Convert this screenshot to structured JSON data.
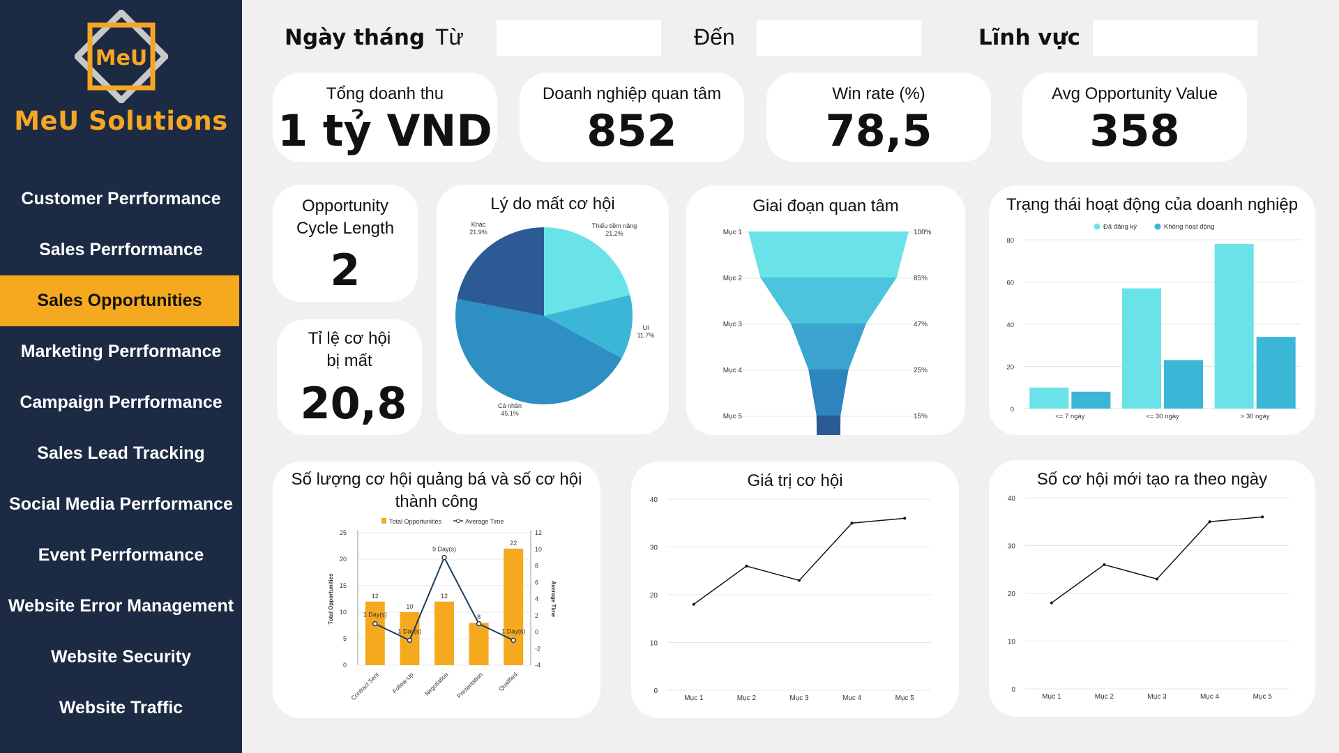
{
  "brand": {
    "logo_text": "MeU",
    "name": "MeU Solutions",
    "accent": "#f5a623"
  },
  "sidebar": {
    "items": [
      {
        "label": "Customer Perrformance"
      },
      {
        "label": "Sales Perrformance"
      },
      {
        "label": "Sales Opportunities",
        "active": true
      },
      {
        "label": "Marketing Perrformance"
      },
      {
        "label": "Campaign Perrformance"
      },
      {
        "label": "Sales Lead Tracking"
      },
      {
        "label": "Social Media Perrformance"
      },
      {
        "label": "Event Perrformance"
      },
      {
        "label": "Website Error Management"
      },
      {
        "label": "Website Security"
      },
      {
        "label": "Website Traffic"
      }
    ]
  },
  "filters": {
    "date_label": "Ngày tháng",
    "from_label": "Từ",
    "to_label": "Đến",
    "field_label": "Lĩnh vực",
    "from_value": "",
    "to_value": "",
    "field_value": ""
  },
  "kpis": {
    "revenue": {
      "label": "Tổng doanh thu",
      "value": "1 tỷ VND"
    },
    "interested": {
      "label": "Doanh nghiệp quan tâm",
      "value": "852"
    },
    "winrate": {
      "label": "Win rate (%)",
      "value": "78,5"
    },
    "avg_value": {
      "label": "Avg Opportunity Value",
      "value": "358"
    },
    "cycle": {
      "label_line1": "Opportunity",
      "label_line2": "Cycle Length",
      "value": "2"
    },
    "lost_rate": {
      "label_line1": "Tỉ lệ cơ hội",
      "label_line2": "bị mất",
      "value": "20,8"
    }
  },
  "chart_data": [
    {
      "type": "pie",
      "title": "Lý do mất cơ hội",
      "slices": [
        {
          "name": "Thiếu tiềm năng",
          "value": 21.2,
          "label": "21.2%",
          "color": "#6ae3e8"
        },
        {
          "name": "UI",
          "value": 11.7,
          "label": "11.7%",
          "color": "#3bb6d6"
        },
        {
          "name": "Cá nhân",
          "value": 45.1,
          "label": "45.1%",
          "color": "#2e8fc2"
        },
        {
          "name": "Khác",
          "value": 21.9,
          "label": "21.9%",
          "color": "#2b5a94"
        }
      ]
    },
    {
      "type": "funnel",
      "title": "Giai đoạn quan tâm",
      "categories": [
        "Mục 1",
        "Mục 2",
        "Mục 3",
        "Mục 4",
        "Mục 5"
      ],
      "values": [
        100,
        85,
        47,
        25,
        15
      ],
      "labels": [
        "100%",
        "85%",
        "47%",
        "25%",
        "15%"
      ],
      "colors": [
        "#6ae3e8",
        "#4cc4de",
        "#3aa3d0",
        "#2e84bd",
        "#2b5a94"
      ]
    },
    {
      "type": "bar",
      "title": "Trạng thái hoạt động của doanh nghiệp",
      "categories": [
        "<= 7 ngày",
        "<= 30 ngày",
        "> 30 ngày"
      ],
      "series": [
        {
          "name": "Đã đăng ký",
          "values": [
            10,
            57,
            78
          ],
          "color": "#6ae3e8"
        },
        {
          "name": "Không hoạt động",
          "values": [
            8,
            23,
            34
          ],
          "color": "#3bb6d6"
        }
      ],
      "ylim": [
        0,
        80
      ],
      "yticks": [
        0,
        20,
        40,
        60,
        80
      ],
      "legend": "top"
    },
    {
      "type": "bar-line",
      "title": "Số lượng cơ hội quảng bá và số cơ hội thành công",
      "categories": [
        "Contract Sent",
        "Follow-Up",
        "Negotiation",
        "Presentation",
        "Qualified"
      ],
      "series": [
        {
          "name": "Total Opportunities",
          "type": "bar",
          "values": [
            12,
            10,
            12,
            8,
            22
          ],
          "color": "#f5a91e"
        },
        {
          "name": "Average Time",
          "type": "line",
          "values": [
            1,
            -1,
            9,
            1,
            -1
          ],
          "point_labels": [
            "1 Day(s)",
            "1 Day(s)",
            "9 Day(s)",
            "",
            "1 Day(s)"
          ],
          "color": "#1c3c5a"
        }
      ],
      "ylabel": "Total Opportunities",
      "y2label": "Average Time",
      "ylim": [
        0,
        25
      ],
      "yticks": [
        0,
        5,
        10,
        15,
        20,
        25
      ],
      "y2lim": [
        -4,
        12
      ],
      "y2ticks": [
        -4,
        -2,
        0,
        2,
        4,
        6,
        8,
        10,
        12
      ],
      "legend": "top"
    },
    {
      "type": "line",
      "title": "Giá trị cơ hội",
      "categories": [
        "Mục 1",
        "Mục 2",
        "Mục 3",
        "Mục 4",
        "Mục 5"
      ],
      "values": [
        18,
        26,
        23,
        35,
        36
      ],
      "ylim": [
        0,
        40
      ],
      "yticks": [
        0,
        10,
        20,
        30,
        40
      ]
    },
    {
      "type": "line",
      "title": "Số cơ hội mới tạo ra theo ngày",
      "categories": [
        "Mục 1",
        "Mục 2",
        "Mục 3",
        "Mục 4",
        "Mục 5"
      ],
      "values": [
        18,
        26,
        23,
        35,
        36
      ],
      "ylim": [
        0,
        40
      ],
      "yticks": [
        0,
        10,
        20,
        30,
        40
      ]
    }
  ]
}
